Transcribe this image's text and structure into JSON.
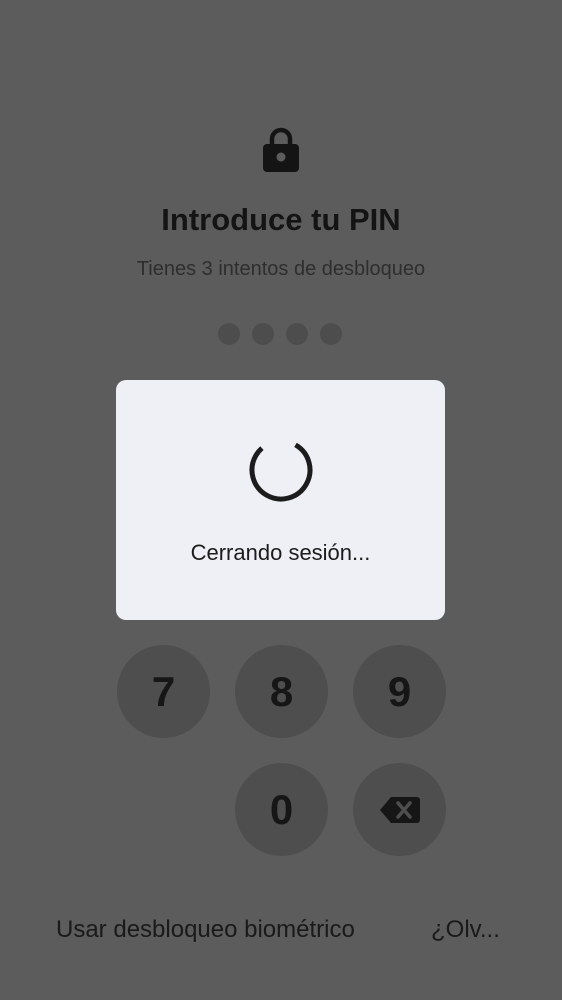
{
  "lock_screen": {
    "title": "Introduce tu PIN",
    "subtitle": "Tienes 3 intentos de desbloqueo",
    "pin_dots_count": 4,
    "keypad": {
      "key_7": "7",
      "key_8": "8",
      "key_9": "9",
      "key_0": "0",
      "backspace_icon": "backspace-icon"
    },
    "biometric_link": "Usar desbloqueo biométrico",
    "forgot_link": "¿Olv..."
  },
  "dialog": {
    "message": "Cerrando sesión...",
    "spinner_icon": "loading-spinner-icon"
  },
  "colors": {
    "scrim_background": "#5c5c5c",
    "dialog_background": "#eff0f5",
    "key_background": "#4e4e4e",
    "text_dark": "#141414"
  }
}
